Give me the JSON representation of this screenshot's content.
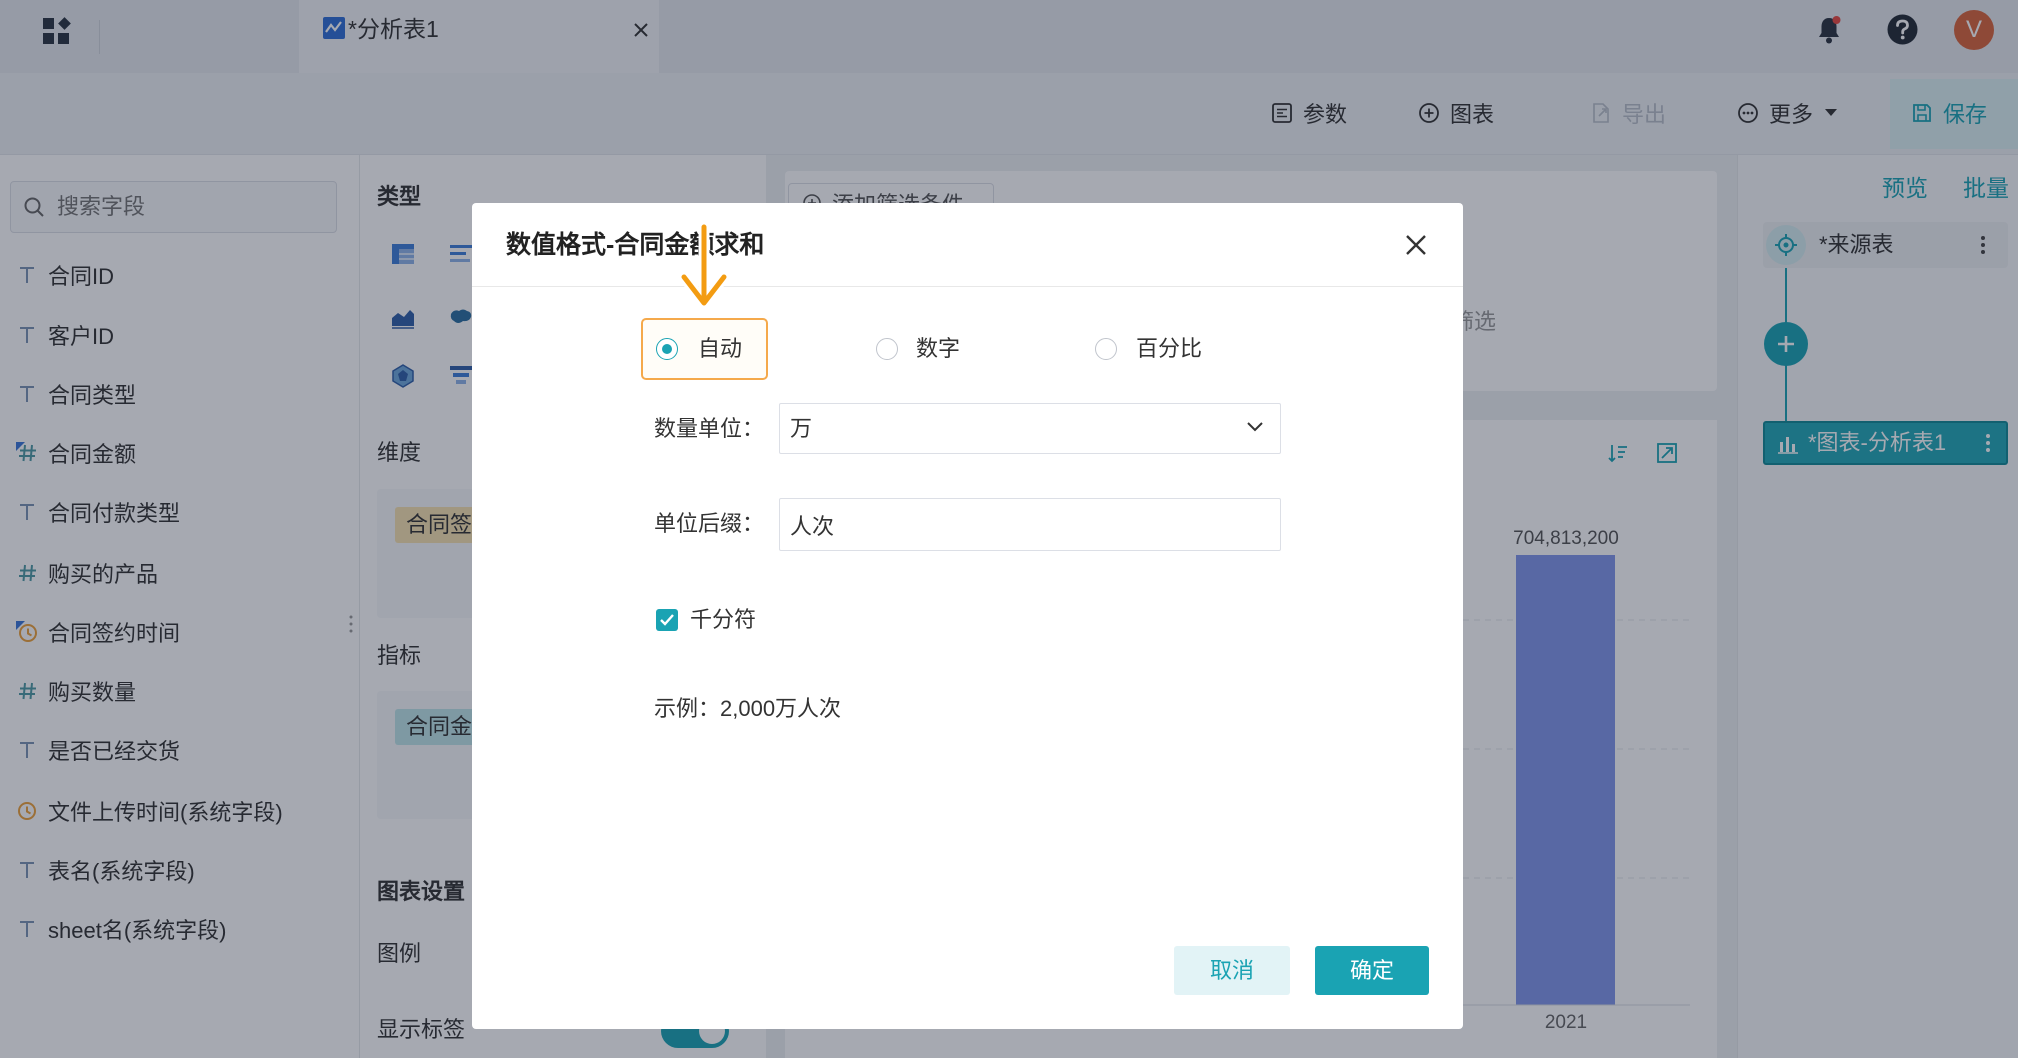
{
  "topbar": {
    "tab_title": "*分析表1",
    "avatar_letter": "V"
  },
  "toolbar": {
    "params": "参数",
    "chart": "图表",
    "export": "导出",
    "more": "更多",
    "save": "保存"
  },
  "field_panel": {
    "search_placeholder": "搜索字段",
    "fields": [
      {
        "type": "text",
        "label": "合同ID"
      },
      {
        "type": "text",
        "label": "客户ID"
      },
      {
        "type": "text",
        "label": "合同类型"
      },
      {
        "type": "number",
        "label": "合同金额",
        "marked": true
      },
      {
        "type": "text",
        "label": "合同付款类型"
      },
      {
        "type": "number",
        "label": "购买的产品"
      },
      {
        "type": "date",
        "label": "合同签约时间",
        "marked": true
      },
      {
        "type": "number",
        "label": "购买数量"
      },
      {
        "type": "text",
        "label": "是否已经交货"
      },
      {
        "type": "date",
        "label": "文件上传时间(系统字段)"
      },
      {
        "type": "text",
        "label": "表名(系统字段)"
      },
      {
        "type": "text",
        "label": "sheet名(系统字段)"
      }
    ]
  },
  "config_panel": {
    "type_title": "类型",
    "dimension_title": "维度",
    "dimension_chip": "合同签",
    "indicator_title": "指标",
    "indicator_chip": "合同金",
    "chart_settings_title": "图表设置",
    "legend_label": "图例",
    "show_label_label": "显示标签",
    "show_label_on": true
  },
  "canvas": {
    "add_filter": "添加筛选条件",
    "filter_hint": "筛选",
    "chart": {
      "category": "2021",
      "value": 704813200,
      "value_label": "704,813,200"
    }
  },
  "flow_panel": {
    "preview": "预览",
    "batch": "批量",
    "nodes": [
      {
        "label": "*来源表",
        "selected": false
      },
      {
        "label": "*图表-分析表1",
        "selected": true
      }
    ]
  },
  "dialog": {
    "title": "数值格式-合同金额求和",
    "format_options": [
      {
        "label": "自动",
        "selected": true
      },
      {
        "label": "数字",
        "selected": false
      },
      {
        "label": "百分比",
        "selected": false
      }
    ],
    "unit_label": "数量单位：",
    "unit_value": "万",
    "suffix_label": "单位后缀：",
    "suffix_value": "人次",
    "thousands_label": "千分符",
    "thousands_checked": true,
    "example": "示例：2,000万人次",
    "cancel": "取消",
    "confirm": "确定"
  },
  "colors": {
    "primary": "#1aa3b3",
    "highlight": "#f5a94b",
    "bar": "#8296eb",
    "avatar": "#d9643a",
    "overlay": "rgba(20,30,50,0.38)"
  }
}
